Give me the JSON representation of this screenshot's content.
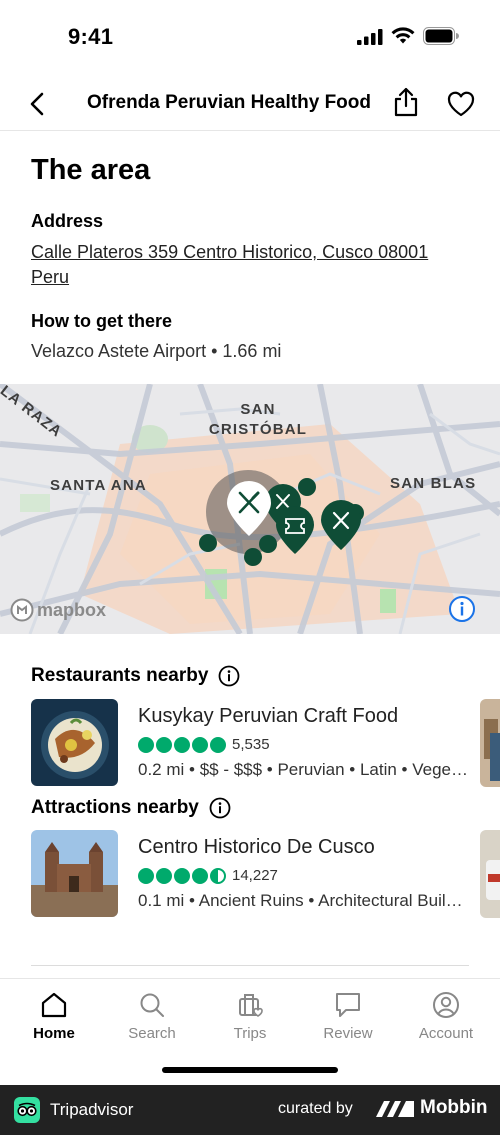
{
  "status": {
    "time": "9:41"
  },
  "header": {
    "title": "Ofrenda Peruvian Healthy Food"
  },
  "area": {
    "heading": "The area",
    "address_label": "Address",
    "address": "Calle Plateros 359 Centro Historico, Cusco 08001 Peru",
    "how_label": "How to get there",
    "how_value": "Velazco Astete Airport • 1.66 mi"
  },
  "map": {
    "labels": {
      "la_raza": "LA RAZA",
      "san_cristobal": "SAN CRISTÓBAL",
      "santa_ana": "SANTA ANA",
      "san_blas": "SAN BLAS"
    },
    "attribution": "mapbox"
  },
  "restaurants": {
    "heading": "Restaurants nearby",
    "item": {
      "name": "Kusykay Peruvian Craft Food",
      "rating": 5,
      "reviews": "5,535",
      "meta": "0.2 mi • $$ - $$$ • Peruvian • Latin • Vegetarian Friendly"
    }
  },
  "attractions": {
    "heading": "Attractions nearby",
    "item": {
      "name": "Centro Historico De Cusco",
      "rating": 4.5,
      "reviews": "14,227",
      "meta": "0.1 mi • Ancient Ruins • Architectural Buildings"
    }
  },
  "tabs": [
    {
      "label": "Home",
      "active": true
    },
    {
      "label": "Search"
    },
    {
      "label": "Trips"
    },
    {
      "label": "Review"
    },
    {
      "label": "Account"
    }
  ],
  "footer": {
    "brand": "Tripadvisor",
    "curated": "curated by",
    "mobbin": "Mobbin"
  },
  "colors": {
    "rating": "#00aa6c",
    "pin": "#0f4d36",
    "footer": "#222222"
  }
}
